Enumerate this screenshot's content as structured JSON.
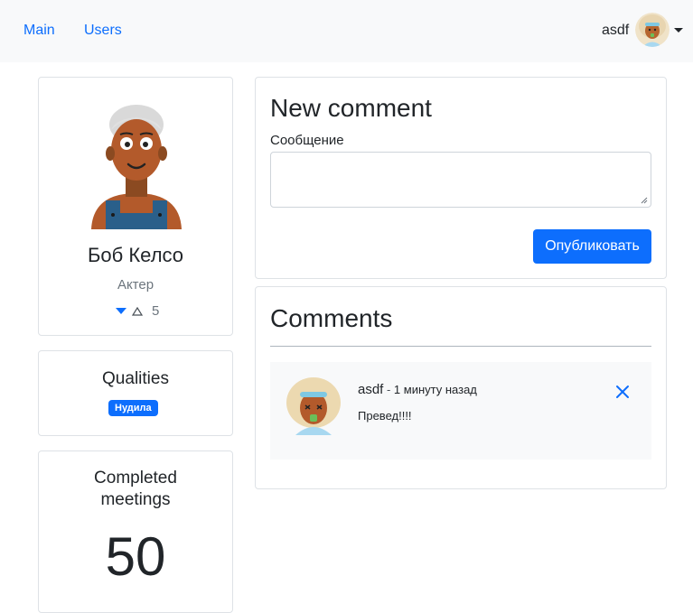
{
  "nav": {
    "links": [
      "Main",
      "Users"
    ],
    "username": "asdf"
  },
  "profile": {
    "name": "Боб Келсо",
    "role": "Актер",
    "rating": "5"
  },
  "qualities": {
    "title": "Qualities",
    "badge": "Нудила"
  },
  "meetings": {
    "title_line1": "Completed",
    "title_line2": "meetings",
    "count": "50"
  },
  "new_comment": {
    "title": "New comment",
    "field_label": "Сообщение",
    "textarea_value": "",
    "submit_label": "Опубликовать"
  },
  "comments": {
    "title": "Comments",
    "items": [
      {
        "author": "asdf",
        "separator": " - ",
        "time": "1 минуту назад",
        "text": "Превед!!!!"
      }
    ]
  },
  "colors": {
    "accent": "#0d6efd",
    "navbar_bg": "#f8f9fa",
    "muted": "#6c757d",
    "border": "#dee2e6"
  },
  "icons": {
    "profile_avatar": "avatar-male-gray-hair",
    "user_avatar": "avatar-user",
    "caret": "caret-down-icon",
    "rate_down": "triangle-down-icon",
    "rate_up": "triangle-up-outline-icon",
    "delete": "close-icon"
  }
}
